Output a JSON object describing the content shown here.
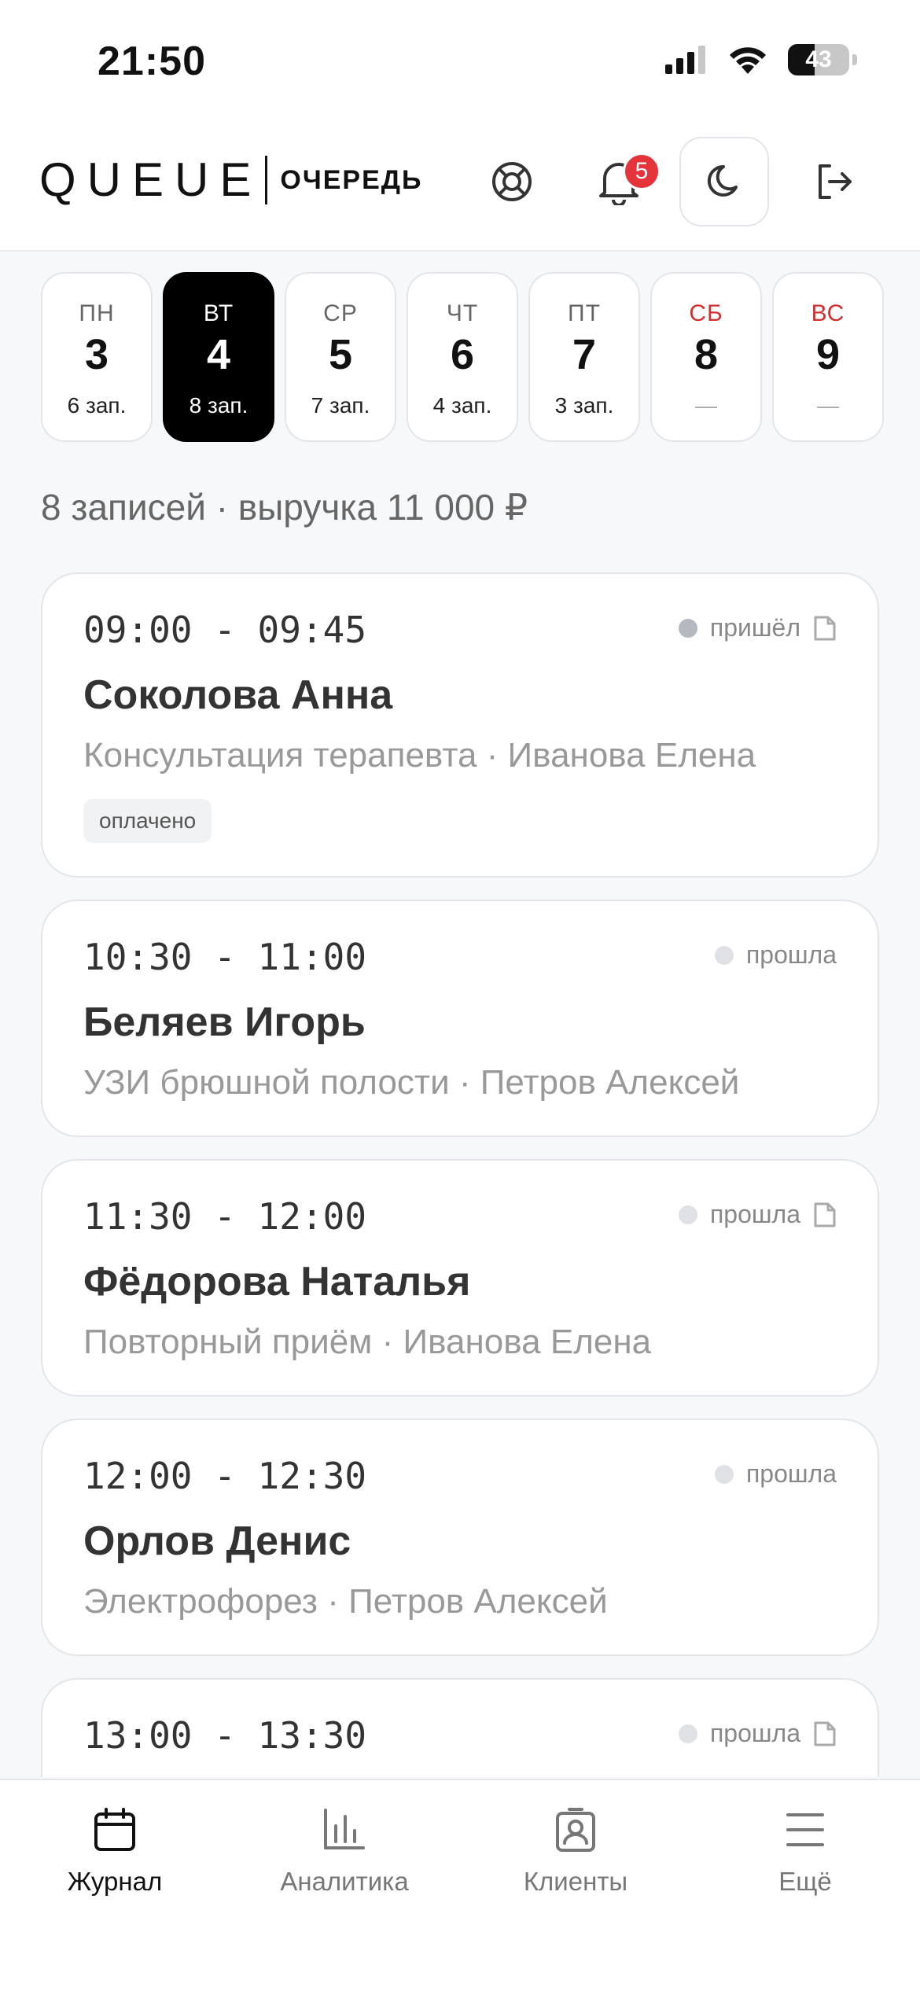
{
  "status_bar": {
    "time": "21:50",
    "battery": "43",
    "battery_level": 0.43
  },
  "header": {
    "logo_main": "QUEUE",
    "logo_sub": "ОЧЕРЕДЬ",
    "notifications_count": "5",
    "icons": [
      "lifebuoy-icon",
      "bell-icon",
      "moon-icon",
      "logout-icon"
    ]
  },
  "days": [
    {
      "name": "ПН",
      "date": "3",
      "count": "6 зап.",
      "weekend": false,
      "active": false
    },
    {
      "name": "ВТ",
      "date": "4",
      "count": "8 зап.",
      "weekend": false,
      "active": true
    },
    {
      "name": "СР",
      "date": "5",
      "count": "7 зап.",
      "weekend": false,
      "active": false
    },
    {
      "name": "ЧТ",
      "date": "6",
      "count": "4 зап.",
      "weekend": false,
      "active": false
    },
    {
      "name": "ПТ",
      "date": "7",
      "count": "3 зап.",
      "weekend": false,
      "active": false
    },
    {
      "name": "СБ",
      "date": "8",
      "count": "—",
      "weekend": true,
      "active": false
    },
    {
      "name": "ВС",
      "date": "9",
      "count": "—",
      "weekend": true,
      "active": false
    }
  ],
  "summary": "8 записей · выручка 11 000 ₽",
  "appointments": [
    {
      "time": "09:00 - 09:45",
      "name": "Соколова Анна",
      "details": "Консультация терапевта · Иванова Елена",
      "status": "пришёл",
      "tag": "оплачено"
    },
    {
      "time": "10:30 - 11:00",
      "name": "Беляев Игорь",
      "details": "УЗИ брюшной полости · Петров Алексей",
      "status": "прошла"
    },
    {
      "time": "11:30 - 12:00",
      "name": "Фёдорова Наталья",
      "details": "Повторный приём · Иванова Елена",
      "status": "прошла"
    },
    {
      "time": "12:00 - 12:30",
      "name": "Орлов Денис",
      "details": "Электрофорез · Петров Алексей",
      "status": "прошла"
    },
    {
      "time": "13:00 - 13:30",
      "name": "",
      "details": "",
      "status": "прошла"
    }
  ],
  "tabs": [
    {
      "label": "Журнал",
      "icon": "calendar-icon",
      "active": true
    },
    {
      "label": "Аналитика",
      "icon": "bar-chart-icon",
      "active": false
    },
    {
      "label": "Клиенты",
      "icon": "contacts-icon",
      "active": false
    },
    {
      "label": "Ещё",
      "icon": "menu-icon",
      "active": false
    }
  ],
  "colors": {
    "active_day_bg": "#000000",
    "weekend": "#d32f2f",
    "badge": "#e5333b"
  }
}
